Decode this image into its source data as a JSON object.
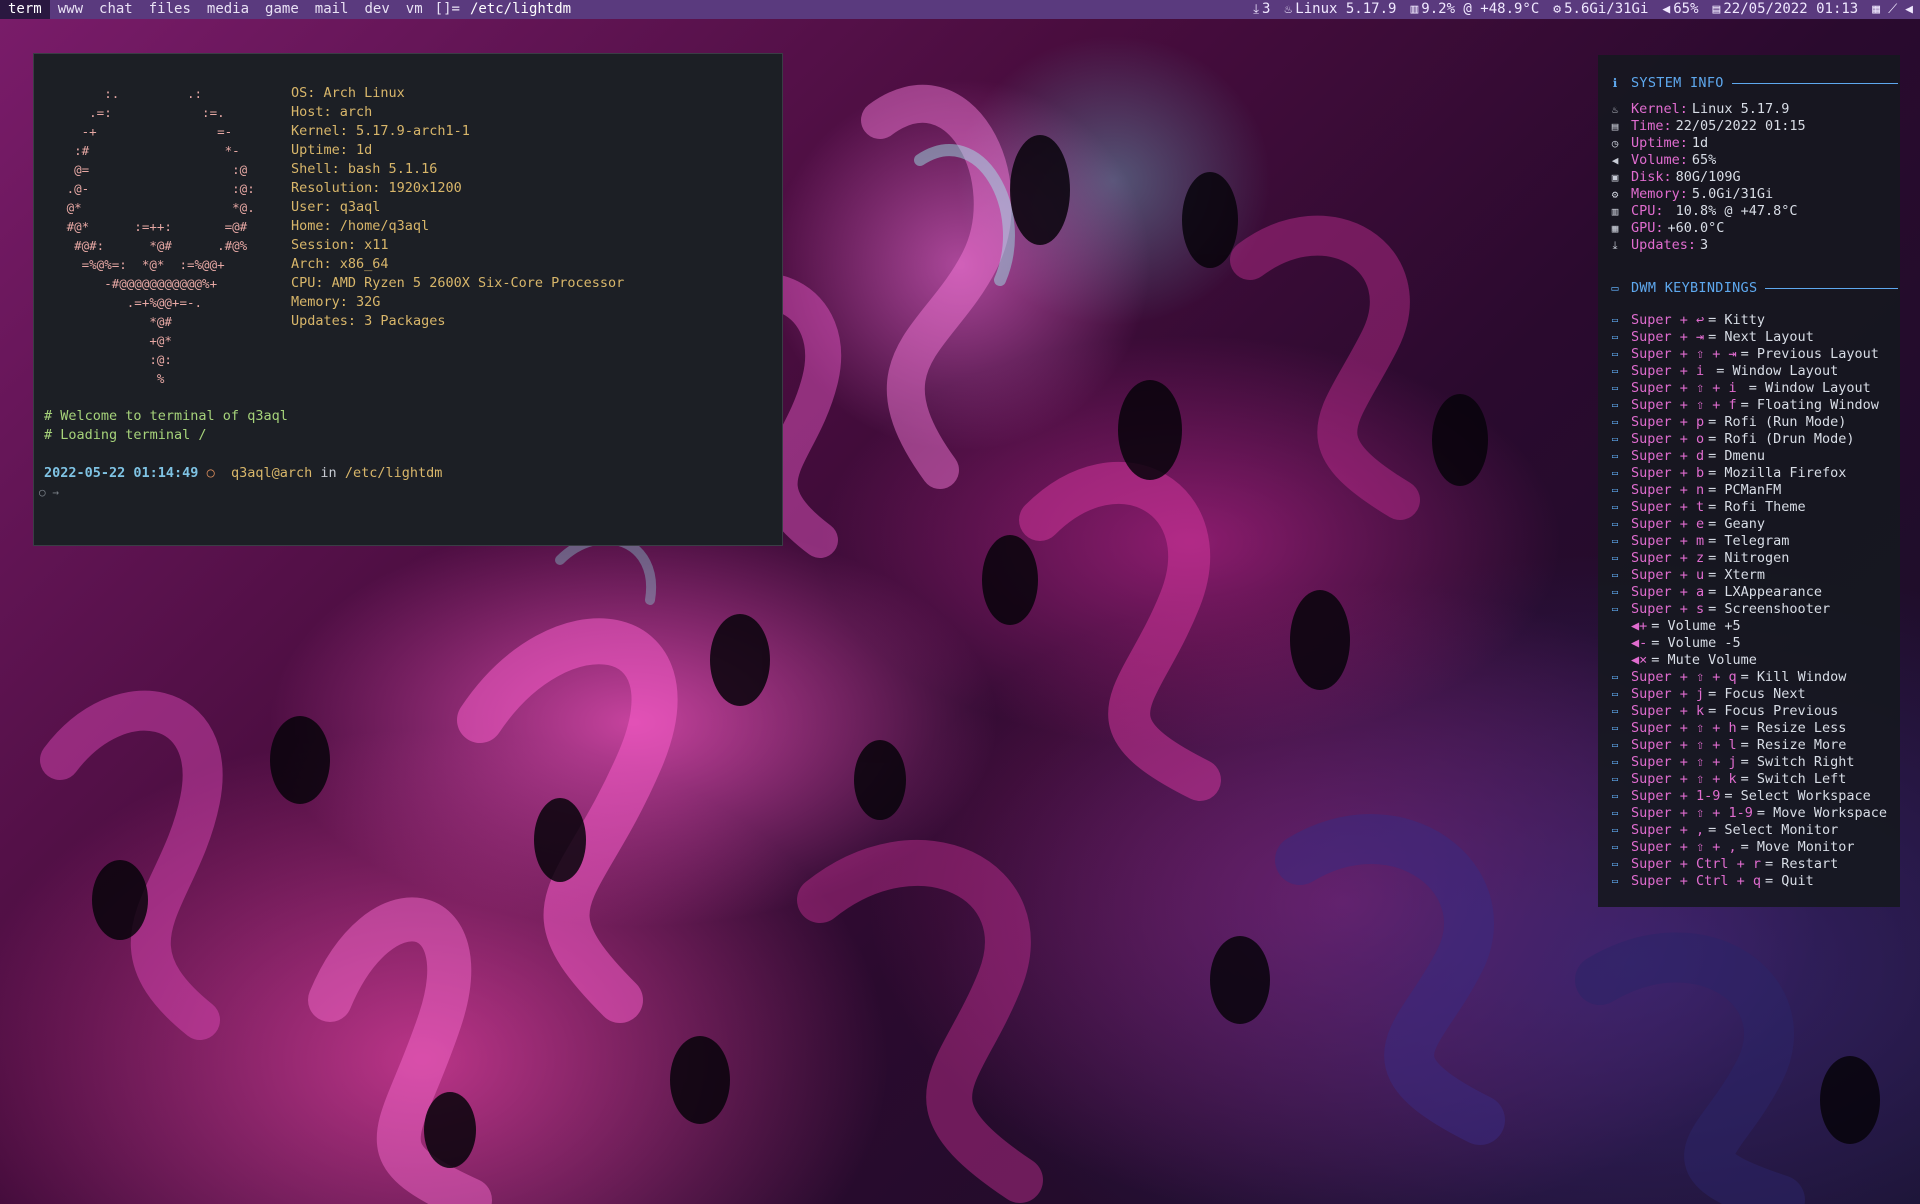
{
  "topbar": {
    "tags": [
      {
        "label": "term",
        "active": true
      },
      {
        "label": "www",
        "active": false
      },
      {
        "label": "chat",
        "active": false
      },
      {
        "label": "files",
        "active": false
      },
      {
        "label": "media",
        "active": false
      },
      {
        "label": "game",
        "active": false
      },
      {
        "label": "mail",
        "active": false
      },
      {
        "label": "dev",
        "active": false
      },
      {
        "label": "vm",
        "active": false
      }
    ],
    "layout_symbol": "[]=",
    "window_title": "/etc/lightdm",
    "status": {
      "updates": "3",
      "kernel": "Linux 5.17.9",
      "cpu": "9.2% @ +48.9°C",
      "memory": "5.6Gi/31Gi",
      "volume": "65%",
      "datetime": "22/05/2022 01:13"
    }
  },
  "terminal": {
    "ascii_logo": "        :.         .:\n      .=:            :=.\n     -+                =-\n    :#                  *-\n    @=                   :@\n   .@-                   :@:\n   @*                    *@.\n   #@*      :=++:       =@#\n    #@#:      *@#      .#@%\n     =%@%=:  *@*  :=%@@+\n        -#@@@@@@@@@@@%+\n           .=+%@@+=-.\n              *@#\n              +@*\n              :@:\n               %",
    "fetch": [
      {
        "key": "OS:",
        "value": "Arch Linux"
      },
      {
        "key": "Host:",
        "value": "arch"
      },
      {
        "key": "Kernel:",
        "value": "5.17.9-arch1-1"
      },
      {
        "key": "Uptime:",
        "value": "1d"
      },
      {
        "key": "Shell:",
        "value": "bash 5.1.16"
      },
      {
        "key": "Resolution:",
        "value": "1920x1200"
      },
      {
        "key": "User:",
        "value": "q3aql"
      },
      {
        "key": "Home:",
        "value": "/home/q3aql"
      },
      {
        "key": "Session:",
        "value": "x11"
      },
      {
        "key": "Arch:",
        "value": "x86_64"
      },
      {
        "key": "CPU:",
        "value": "AMD Ryzen 5 2600X Six-Core Processor"
      },
      {
        "key": "Memory:",
        "value": "32G"
      },
      {
        "key": "Updates:",
        "value": "3 Packages"
      }
    ],
    "comments": [
      "# Welcome to terminal of q3aql",
      "# Loading terminal /"
    ],
    "prompt": {
      "date": "2022-05-22 01:14:49",
      "sep": "○",
      "user_host": "q3aql@arch",
      "in": "in",
      "dir": "/etc/lightdm"
    },
    "cursor": "○ →"
  },
  "conky": {
    "system_info_title": "SYSTEM INFO",
    "system_info": [
      {
        "icon": "linux-icon",
        "glyph": "♨",
        "label": "Kernel:",
        "value": "Linux 5.17.9"
      },
      {
        "icon": "calendar-icon",
        "glyph": "▤",
        "label": "Time:",
        "value": "22/05/2022 01:15"
      },
      {
        "icon": "clock-icon",
        "glyph": "◷",
        "label": "Uptime:",
        "value": "1d"
      },
      {
        "icon": "volume-icon",
        "glyph": "◀",
        "label": "Volume:",
        "value": "65%"
      },
      {
        "icon": "disk-icon",
        "glyph": "▣",
        "label": "Disk:",
        "value": "80G/109G"
      },
      {
        "icon": "memory-icon",
        "glyph": "⚙",
        "label": "Memory:",
        "value": "5.0Gi/31Gi"
      },
      {
        "icon": "cpu-icon",
        "glyph": "▥",
        "label": "CPU:",
        "value": " 10.8% @ +47.8°C"
      },
      {
        "icon": "gpu-icon",
        "glyph": "▦",
        "label": "GPU:",
        "value": "+60.0°C"
      },
      {
        "icon": "download-icon",
        "glyph": "⤓",
        "label": "Updates:",
        "value": "3"
      }
    ],
    "keybindings_title": "DWM KEYBINDINGS",
    "keybindings": [
      {
        "icon": "keyboard-icon",
        "combo": "Super + ↩",
        "desc": "= Kitty"
      },
      {
        "icon": "keyboard-icon",
        "combo": "Super + ⇥",
        "desc": "= Next Layout"
      },
      {
        "icon": "keyboard-icon",
        "combo": "Super + ⇧ + ⇥",
        "desc": "= Previous Layout"
      },
      {
        "icon": "keyboard-icon",
        "combo": "Super + i ",
        "desc": "= Window Layout"
      },
      {
        "icon": "keyboard-icon",
        "combo": "Super + ⇧ + i ",
        "desc": "= Window Layout"
      },
      {
        "icon": "keyboard-icon",
        "combo": "Super + ⇧ + f",
        "desc": "= Floating Window"
      },
      {
        "icon": "keyboard-icon",
        "combo": "Super + p",
        "desc": "= Rofi (Run Mode)"
      },
      {
        "icon": "keyboard-icon",
        "combo": "Super + o",
        "desc": "= Rofi (Drun Mode)"
      },
      {
        "icon": "keyboard-icon",
        "combo": "Super + d",
        "desc": "= Dmenu"
      },
      {
        "icon": "keyboard-icon",
        "combo": "Super + b",
        "desc": "= Mozilla Firefox"
      },
      {
        "icon": "keyboard-icon",
        "combo": "Super + n",
        "desc": "= PCManFM"
      },
      {
        "icon": "keyboard-icon",
        "combo": "Super + t",
        "desc": "= Rofi Theme"
      },
      {
        "icon": "keyboard-icon",
        "combo": "Super + e",
        "desc": "= Geany"
      },
      {
        "icon": "keyboard-icon",
        "combo": "Super + m",
        "desc": "= Telegram"
      },
      {
        "icon": "keyboard-icon",
        "combo": "Super + z",
        "desc": "= Nitrogen"
      },
      {
        "icon": "keyboard-icon",
        "combo": "Super + u",
        "desc": "= Xterm"
      },
      {
        "icon": "keyboard-icon",
        "combo": "Super + a",
        "desc": "= LXAppearance"
      },
      {
        "icon": "keyboard-icon",
        "combo": "Super + s",
        "desc": "= Screenshooter"
      },
      {
        "icon": "volume-up-icon",
        "combo": "◀+",
        "desc": "= Volume +5"
      },
      {
        "icon": "volume-down-icon",
        "combo": "◀-",
        "desc": "= Volume -5"
      },
      {
        "icon": "mute-icon",
        "combo": "◀×",
        "desc": "= Mute Volume"
      },
      {
        "icon": "keyboard-icon",
        "combo": "Super + ⇧ + q",
        "desc": "= Kill Window"
      },
      {
        "icon": "keyboard-icon",
        "combo": "Super + j",
        "desc": "= Focus Next"
      },
      {
        "icon": "keyboard-icon",
        "combo": "Super + k",
        "desc": "= Focus Previous"
      },
      {
        "icon": "keyboard-icon",
        "combo": "Super + ⇧ + h",
        "desc": "= Resize Less"
      },
      {
        "icon": "keyboard-icon",
        "combo": "Super + ⇧ + l",
        "desc": "= Resize More"
      },
      {
        "icon": "keyboard-icon",
        "combo": "Super + ⇧ + j",
        "desc": "= Switch Right"
      },
      {
        "icon": "keyboard-icon",
        "combo": "Super + ⇧ + k",
        "desc": "= Switch Left"
      },
      {
        "icon": "keyboard-icon",
        "combo": "Super + 1-9",
        "desc": "= Select Workspace"
      },
      {
        "icon": "keyboard-icon",
        "combo": "Super + ⇧ + 1-9",
        "desc": "= Move Workspace"
      },
      {
        "icon": "keyboard-icon",
        "combo": "Super + ,",
        "desc": "= Select Monitor"
      },
      {
        "icon": "keyboard-icon",
        "combo": "Super + ⇧ + ,",
        "desc": "= Move Monitor"
      },
      {
        "icon": "keyboard-icon",
        "combo": "Super + Ctrl + r",
        "desc": "= Restart"
      },
      {
        "icon": "keyboard-icon",
        "combo": "Super + Ctrl + q",
        "desc": "= Quit"
      }
    ]
  },
  "colors": {
    "bar_bg": "#5a3a7e",
    "active_tag_bg": "#2a1840",
    "terminal_bg": "#1c1f25",
    "panel_bg": "#161820",
    "accent_blue": "#5ea8ee",
    "accent_pink": "#e06ccf",
    "fetch_yellow": "#d8b66a",
    "comment_green": "#a6d37a",
    "logo_salmon": "#e7a8a4"
  }
}
